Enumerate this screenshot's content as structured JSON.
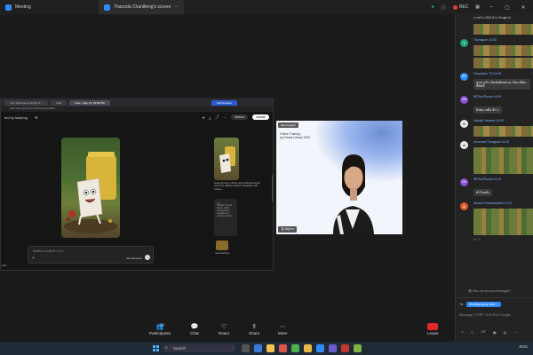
{
  "titlebar": {
    "meeting_tab": "Meeting",
    "share_tab": "Thanoda Chanlileng's screen",
    "rec_label": "REC"
  },
  "shared_screen": {
    "browser_tabs": [
      "Your Channels & Script Vi...",
      "Chat",
      "Flow - May 13, 23:06 PM",
      "Add Session"
    ],
    "address": "https://labs.google/fx/tools/flow/project/e8b4f...",
    "page_header": "ted by ladybug",
    "pill_primary": "ubdate",
    "pill_secondary": "Search",
    "thumb_caption": "Image Prompt: A Pixar style anthropomorphic roll of old, slightly wrinkled newspaper with curious...",
    "side_card_text": "Narrator: An old broom, with a strong woven reputation for mischief and fun.",
    "small_caption": "newsmachines",
    "prompt_placeholder": "พิมพ์ข้อความเพื่อสร้างภาพ",
    "model_label": "Nano Banana 2",
    "bottom_text": "iludu"
  },
  "camera": {
    "logo": "Electrograph",
    "title_line1": "Online Training",
    "title_line2": "by Khuda Library 2026",
    "name": "ดิญ่าดา"
  },
  "chat": {
    "header_text": "การสร้าง VDO ด้วย Google AI",
    "messages": [
      {
        "initial": "T",
        "color": "#1fa678",
        "sender": "Thanaporn 14:08",
        "text": "",
        "image": true
      },
      {
        "initial": "KT",
        "color": "#2d8cff",
        "sender": "Kanyakorn TH 14:08",
        "text": "ลูกทางรัก เกิดข้อผิดพลาด เปิดเปลี่ยนพิชิตนี้",
        "image": false
      },
      {
        "initial": "Ch",
        "color": "#8a4fd6",
        "sender": "ชินี จิตกรีนเทพ 14:09",
        "text": "ยังต่อ เหลือ อีก 1",
        "image": false
      },
      {
        "initial": "S",
        "color": "#e9e9e9",
        "sender": "Sakdijh Yahatha 14:09",
        "text": "",
        "image": true
      },
      {
        "initial": "A",
        "color": "#e9e9e9",
        "sender": "Amornrat Thongkam 14:10",
        "text": "",
        "image": true,
        "tall": true
      },
      {
        "initial": "Ch",
        "color": "#8a4fd6",
        "sender": "ชินี จิตกรีนเทพ 14:10",
        "text": "ทำไมหลัง",
        "image": false
      },
      {
        "initial": "A",
        "color": "#e05a2a",
        "sender": "Arkana Petrarwasichol 14:10",
        "text": "",
        "image": true,
        "tall": true
      }
    ],
    "who_can_see": "Who can see your messages?",
    "to_label": "To:",
    "to_target": "Meeting group chat",
    "compose_placeholder": "Message การทำ VDO ด้วย Google"
  },
  "toolbar": {
    "participants_label": "Participants",
    "participants_count": "250",
    "chat_label": "Chat",
    "react_label": "React",
    "share_label": "Share",
    "more_label": "More",
    "leave_label": "Leave"
  },
  "taskbar": {
    "search_placeholder": "Search",
    "tray": "ENG"
  }
}
